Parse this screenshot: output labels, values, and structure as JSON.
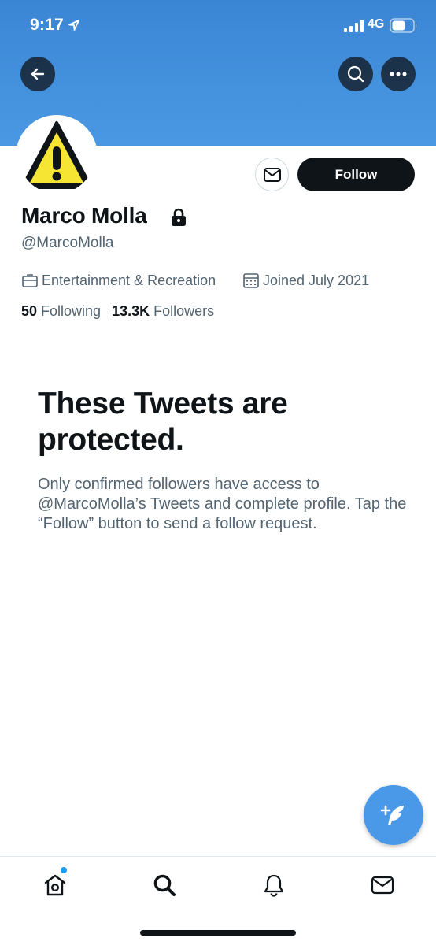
{
  "status_bar": {
    "time": "9:17",
    "network": "4G"
  },
  "profile": {
    "display_name": "Marco Molla",
    "handle": "@MarcoMolla",
    "category": "Entertainment & Recreation",
    "joined": "Joined July 2021",
    "following_count": "50",
    "following_label": "Following",
    "followers_count": "13.3K",
    "followers_label": "Followers",
    "protected": true
  },
  "actions": {
    "follow_label": "Follow"
  },
  "protected_notice": {
    "title": "These Tweets are protected.",
    "body": "Only confirmed followers have access to @MarcoMolla’s Tweets and complete profile. Tap the “Follow” button to send a follow request."
  },
  "tab_bar": {
    "items": [
      {
        "name": "home",
        "icon": "home-icon",
        "has_notification_dot": true
      },
      {
        "name": "search",
        "icon": "search-icon"
      },
      {
        "name": "notifications",
        "icon": "bell-icon"
      },
      {
        "name": "messages",
        "icon": "envelope-icon"
      }
    ]
  },
  "colors": {
    "banner": "#4a98e4",
    "accent": "#1d9bf0",
    "follow_button_bg": "#0f1419",
    "secondary_text": "#536471"
  }
}
